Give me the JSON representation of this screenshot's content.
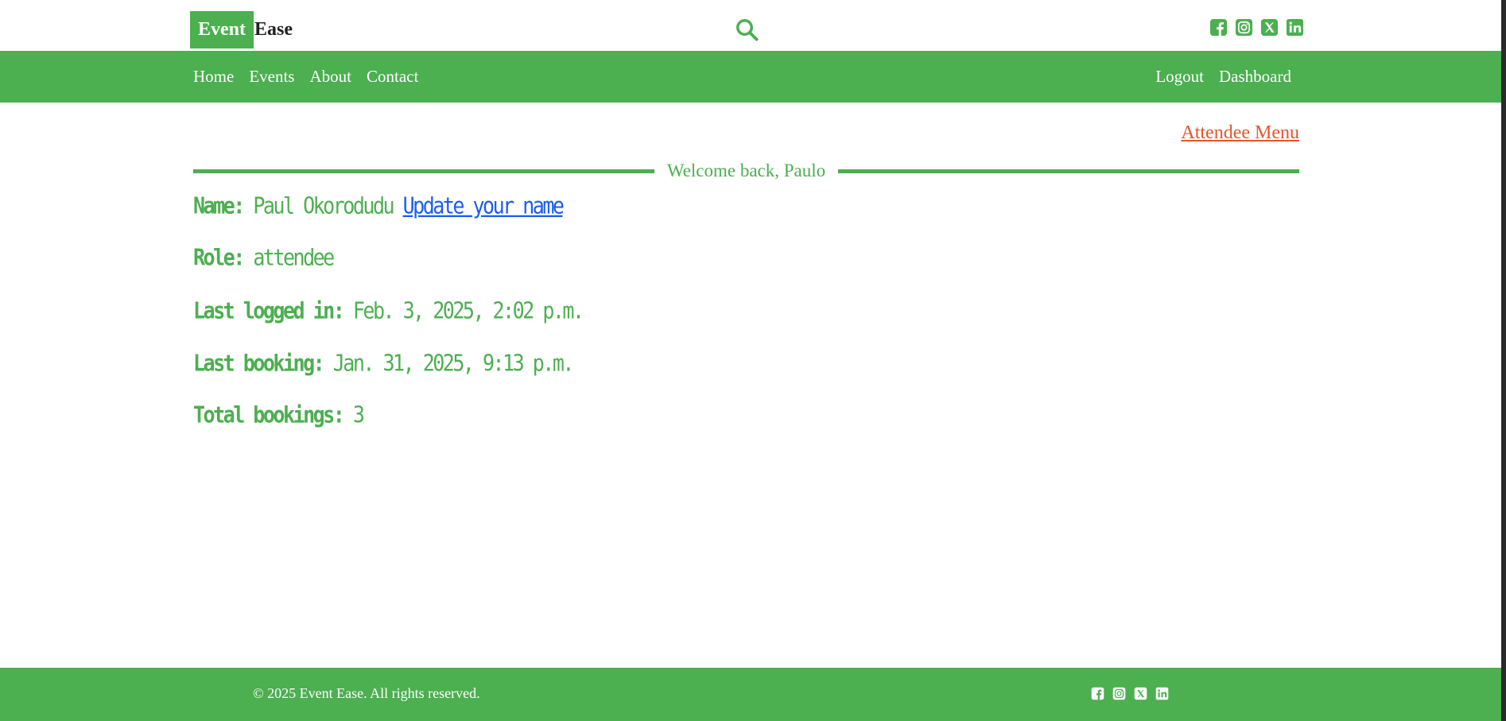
{
  "brand": {
    "part1": "Event",
    "part2": "Ease"
  },
  "header": {
    "search_icon": "search-icon",
    "social_icons": [
      "facebook-icon",
      "instagram-icon",
      "x-icon",
      "linkedin-icon"
    ]
  },
  "nav": {
    "left": [
      "Home",
      "Events",
      "About",
      "Contact"
    ],
    "right": [
      "Logout",
      "Dashboard"
    ]
  },
  "main": {
    "attendee_menu": "Attendee Menu",
    "welcome": "Welcome back, Paulo",
    "name_label": "Name:",
    "name_value": "Paul Okorodudu",
    "update_link": "Update your name",
    "role_label": "Role:",
    "role_value": "attendee",
    "last_login_label": "Last logged in:",
    "last_login_value": "Feb. 3, 2025, 2:02 p.m.",
    "last_booking_label": "Last booking:",
    "last_booking_value": "Jan. 31, 2025, 9:13 p.m.",
    "total_bookings_label": "Total bookings:",
    "total_bookings_value": "3"
  },
  "footer": {
    "copyright": "© 2025 Event Ease. All rights reserved."
  },
  "colors": {
    "brand_green": "#4caf50",
    "accent_orange": "#e8532b",
    "link_blue": "#1a5cf5"
  }
}
